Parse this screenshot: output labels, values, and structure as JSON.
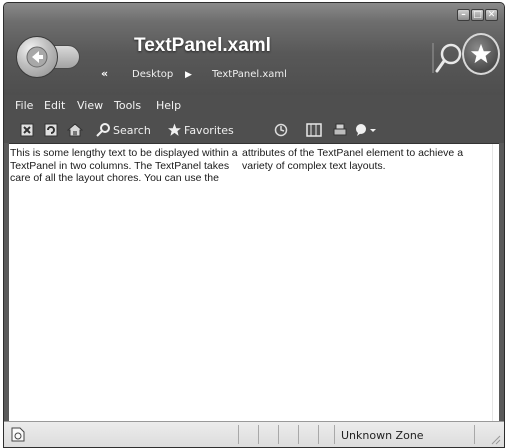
{
  "window": {
    "title": "TextPanel.xaml",
    "breadcrumb_separator": "«",
    "breadcrumb": [
      "Desktop",
      "TextPanel.xaml"
    ],
    "breadcrumb_arrow": "▶",
    "controls": [
      "–",
      "□",
      "✕"
    ]
  },
  "menu": [
    "File",
    "Edit",
    "View",
    "Tools",
    "Help"
  ],
  "toolbar": {
    "search_label": "Search",
    "favorites_label": "Favorites",
    "icons": [
      "stop-icon",
      "refresh-icon",
      "home-icon",
      "search-icon",
      "favorites-star-icon",
      "history-icon",
      "media-icon",
      "print-icon",
      "messenger-icon"
    ]
  },
  "content": {
    "column1": "This is some lengthy text to be displayed within a TextPanel in two columns. The TextPanel takes care of all the layout chores. You can use the",
    "column2": "attributes of the TextPanel element to achieve a variety of complex text layouts."
  },
  "status": {
    "zone": "Unknown Zone"
  },
  "colors": {
    "chrome": "#4f4f4f",
    "content_bg": "#ffffff",
    "status_bg": "#e4e4e4"
  }
}
